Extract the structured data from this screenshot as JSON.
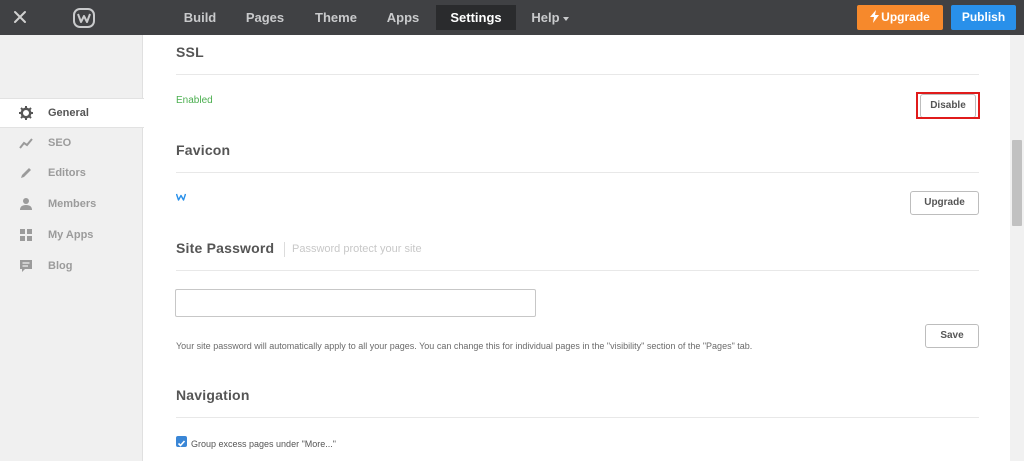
{
  "topbar": {
    "tabs": [
      {
        "label": "Build"
      },
      {
        "label": "Pages"
      },
      {
        "label": "Theme"
      },
      {
        "label": "Apps"
      },
      {
        "label": "Settings"
      },
      {
        "label": "Help"
      }
    ],
    "upgrade_label": "Upgrade",
    "publish_label": "Publish"
  },
  "sidebar": {
    "items": [
      {
        "label": "General",
        "icon": "gear-icon"
      },
      {
        "label": "SEO",
        "icon": "trend-icon"
      },
      {
        "label": "Editors",
        "icon": "pencil-icon"
      },
      {
        "label": "Members",
        "icon": "person-icon"
      },
      {
        "label": "My Apps",
        "icon": "grid-icon"
      },
      {
        "label": "Blog",
        "icon": "comment-icon"
      }
    ]
  },
  "ssl": {
    "title": "SSL",
    "status": "Enabled",
    "button": "Disable"
  },
  "favicon": {
    "title": "Favicon",
    "button": "Upgrade"
  },
  "password": {
    "title": "Site Password",
    "subtitle": "Password protect your site",
    "value": "",
    "help": "Your site password will automatically apply to all your pages. You can change this for individual pages in the \"visibility\" section of the \"Pages\" tab.",
    "save": "Save"
  },
  "navigation": {
    "title": "Navigation",
    "checkbox_label": "Group excess pages under \"More...\"",
    "checked": true
  },
  "colors": {
    "topbar": "#404144",
    "upgrade": "#f6892c",
    "publish": "#2990ea",
    "enabled": "#4caf50",
    "highlight": "#e01b1b"
  }
}
